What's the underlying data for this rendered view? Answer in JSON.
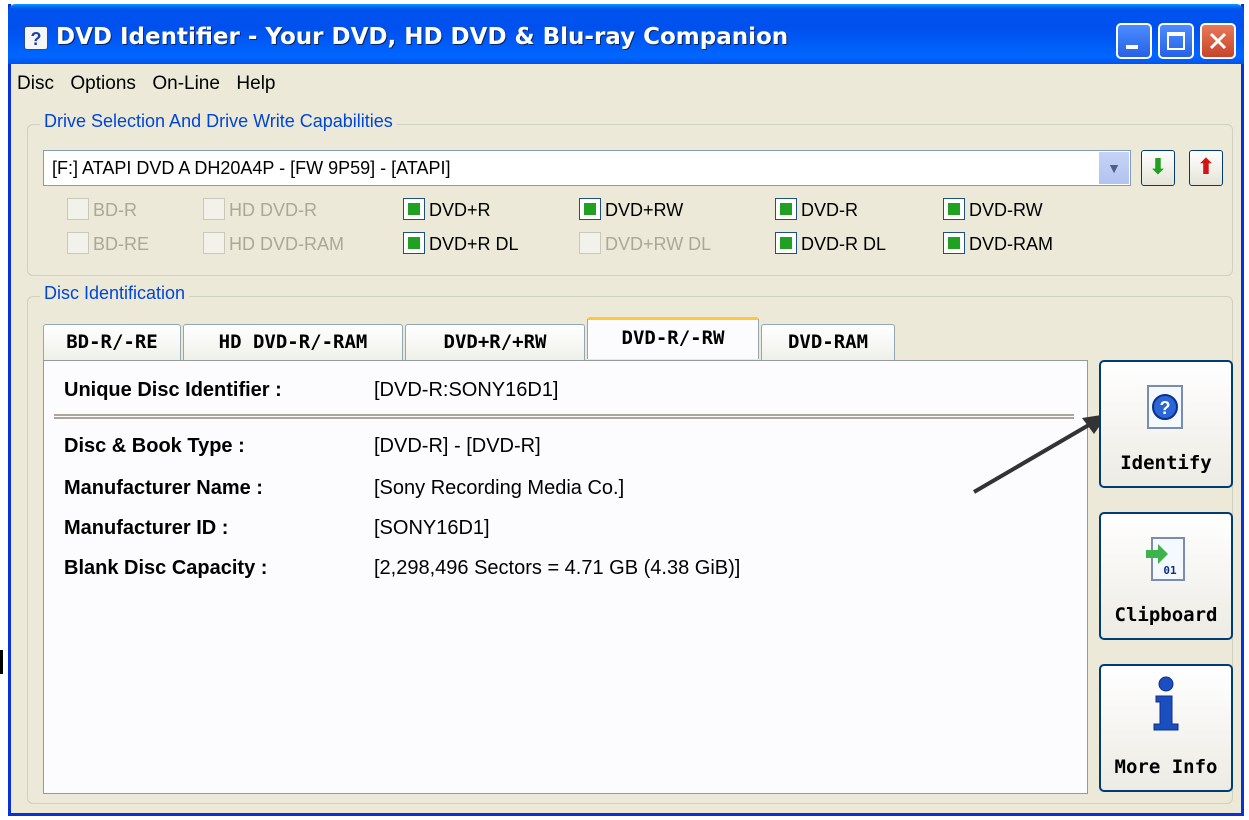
{
  "window": {
    "title": "DVD Identifier - Your DVD, HD DVD & Blu-ray Companion",
    "icon": "help-icon"
  },
  "menu": [
    "Disc",
    "Options",
    "On-Line",
    "Help"
  ],
  "drive_group": {
    "label": "Drive Selection And Drive Write Capabilities",
    "selected_drive": "[F:] ATAPI DVD A  DH20A4P - [FW 9P59] - [ATAPI]",
    "down_icon": "green-down-arrow-icon",
    "up_icon": "red-up-arrow-icon"
  },
  "capabilities": [
    {
      "label": "BD-R",
      "checked": false,
      "enabled": false
    },
    {
      "label": "BD-RE",
      "checked": false,
      "enabled": false
    },
    {
      "label": "HD DVD-R",
      "checked": false,
      "enabled": false
    },
    {
      "label": "HD DVD-RAM",
      "checked": false,
      "enabled": false
    },
    {
      "label": "DVD+R",
      "checked": true,
      "enabled": true
    },
    {
      "label": "DVD+R DL",
      "checked": true,
      "enabled": true
    },
    {
      "label": "DVD+RW",
      "checked": true,
      "enabled": true
    },
    {
      "label": "DVD+RW DL",
      "checked": false,
      "enabled": false
    },
    {
      "label": "DVD-R",
      "checked": true,
      "enabled": true
    },
    {
      "label": "DVD-R DL",
      "checked": true,
      "enabled": true
    },
    {
      "label": "DVD-RW",
      "checked": true,
      "enabled": true
    },
    {
      "label": "DVD-RAM",
      "checked": true,
      "enabled": true
    }
  ],
  "disc_group": {
    "label": "Disc Identification",
    "tabs": [
      "BD-R/-RE",
      "HD DVD-R/-RAM",
      "DVD+R/+RW",
      "DVD-R/-RW",
      "DVD-RAM"
    ],
    "active_tab": "DVD-R/-RW"
  },
  "disc_info": {
    "uid_label": "Unique Disc Identifier :",
    "uid_value": "[DVD-R:SONY16D1]",
    "book_type_label": "Disc & Book Type :",
    "book_type_value": "[DVD-R] - [DVD-R]",
    "manufacturer_name_label": "Manufacturer Name :",
    "manufacturer_name_value": "[Sony Recording Media Co.]",
    "manufacturer_id_label": "Manufacturer ID :",
    "manufacturer_id_value": "[SONY16D1]",
    "capacity_label": "Blank Disc Capacity :",
    "capacity_value": "[2,298,496 Sectors = 4.71 GB (4.38 GiB)]"
  },
  "side_buttons": {
    "identify": "Identify",
    "clipboard": "Clipboard",
    "more_info": "More Info"
  },
  "colors": {
    "title_bar": "#0054e3",
    "group_label": "#0046d5",
    "checked_fill": "#21a121",
    "active_tab_accent": "#ffc83c"
  }
}
